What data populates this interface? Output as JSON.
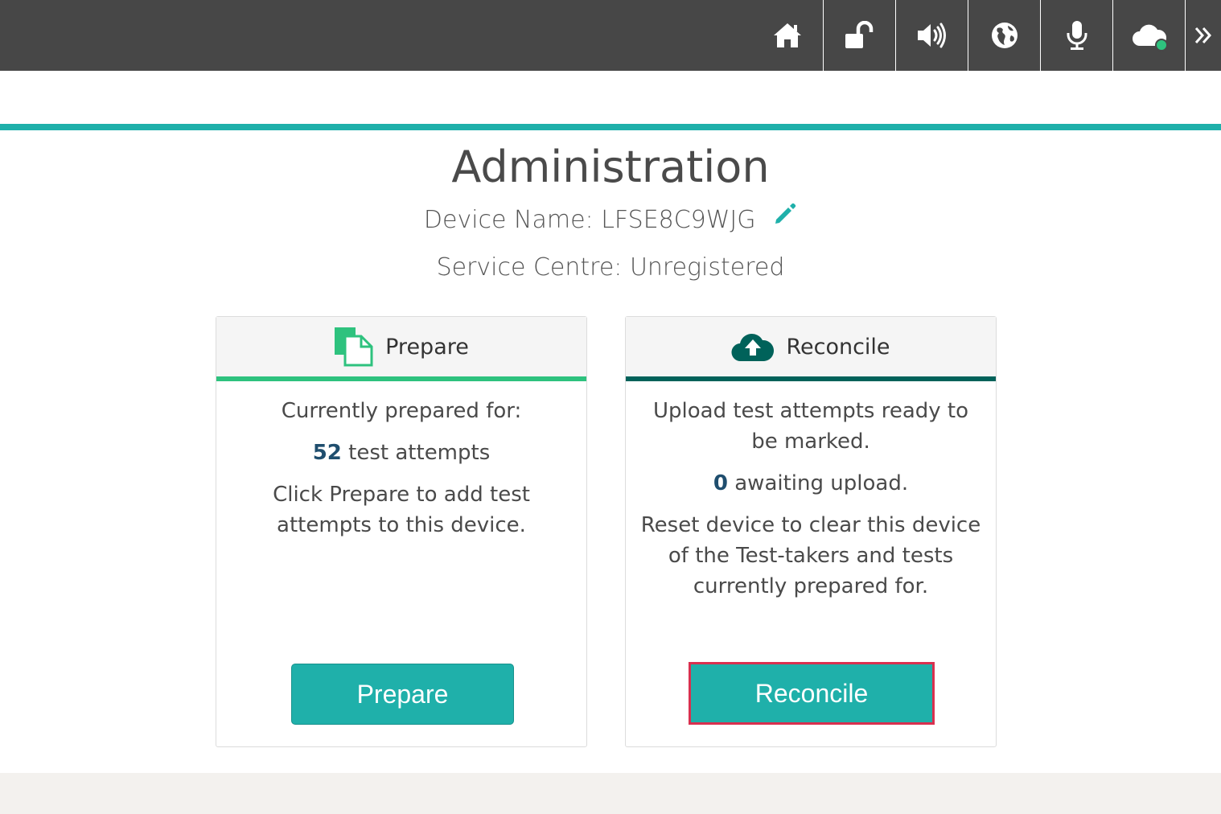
{
  "topbar": {
    "buttons": [
      {
        "name": "home-button",
        "icon": "home-icon"
      },
      {
        "name": "lock-button",
        "icon": "unlock-icon"
      },
      {
        "name": "volume-button",
        "icon": "volume-icon"
      },
      {
        "name": "language-button",
        "icon": "globe-icon"
      },
      {
        "name": "microphone-button",
        "icon": "microphone-icon"
      },
      {
        "name": "cloud-status-button",
        "icon": "cloud-icon",
        "status_color": "#2ec27e"
      },
      {
        "name": "expand-button",
        "icon": "double-chevron-right-icon"
      }
    ]
  },
  "colors": {
    "accent": "#1fb0aa",
    "prepare_accent": "#2ec27e",
    "reconcile_accent": "#00625a",
    "highlight": "#d9304f"
  },
  "page": {
    "title": "Administration",
    "device_label": "Device Name:",
    "device_name": "LFSE8C9WJG",
    "service_label": "Service Centre:",
    "service_value": "Unregistered"
  },
  "prepare_card": {
    "heading": "Prepare",
    "line1": "Currently prepared for:",
    "count": "52",
    "count_suffix": "test attempts",
    "instructions": "Click Prepare to add test attempts to this device.",
    "button_label": "Prepare"
  },
  "reconcile_card": {
    "heading": "Reconcile",
    "line1": "Upload test attempts ready to be marked.",
    "count": "0",
    "count_suffix": "awaiting upload.",
    "instructions": "Reset device to clear this device of the Test-takers and tests currently prepared for.",
    "button_label": "Reconcile"
  }
}
